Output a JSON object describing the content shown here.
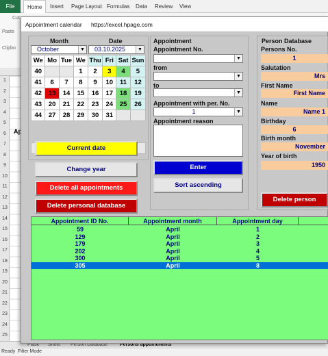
{
  "excel": {
    "tabs": [
      "File",
      "Home",
      "Insert",
      "Page Layout",
      "Formulas",
      "Data",
      "Review",
      "View"
    ],
    "ribbon_labels": [
      "Cut",
      "Paste",
      "Clipbo"
    ],
    "row_headers": [
      "1",
      "2",
      "3",
      "4",
      "5",
      "6",
      "7",
      "8",
      "9",
      "10",
      "11",
      "12",
      "13",
      "14",
      "15",
      "16",
      "17",
      "18",
      "19",
      "20",
      "21",
      "22",
      "23",
      "24",
      "25"
    ],
    "cell_text": "Ap",
    "sheet_tabs": [
      "Plask",
      "Sheet",
      "Person Database",
      "Persons appointments"
    ],
    "status": [
      "Ready",
      "Filter Mode"
    ]
  },
  "dialog": {
    "title": "Appointment calendar",
    "url": "https://excel.hpage.com"
  },
  "calendar": {
    "month_label": "Month",
    "date_label": "Date",
    "month_value": "October",
    "date_value": "03.10.2025",
    "day_headers": [
      "We",
      "Mo",
      "Tue",
      "We",
      "Thu",
      "Fri",
      "Sat",
      "Sun"
    ],
    "rows": [
      [
        "40",
        "",
        "",
        "1",
        "2",
        "3",
        "4",
        "5"
      ],
      [
        "41",
        "6",
        "7",
        "8",
        "9",
        "10",
        "11",
        "12"
      ],
      [
        "42",
        "13",
        "14",
        "15",
        "16",
        "17",
        "18",
        "19"
      ],
      [
        "43",
        "20",
        "21",
        "22",
        "23",
        "24",
        "25",
        "26"
      ],
      [
        "44",
        "27",
        "28",
        "29",
        "30",
        "31",
        "",
        ""
      ]
    ],
    "colors": {
      "today": "#ffff00",
      "weekend": "#7bde7b",
      "selected_week": "#e00000"
    }
  },
  "buttons": {
    "current_date": "Current date",
    "change_year": "Change year",
    "delete_all": "Delete all appointments",
    "delete_db": "Delete personal database",
    "enter": "Enter",
    "sort": "Sort ascending",
    "delete_person": "Delete person"
  },
  "appointment": {
    "heading": "Appointment",
    "no_label": "Appointment No.",
    "from_label": "from",
    "to_label": "to",
    "with_label": "Appointment with per. No.",
    "with_value": "1",
    "reason_label": "Appointment reason"
  },
  "person": {
    "heading": "Person Database",
    "persons_no_label": "Persons No.",
    "persons_no_value": "1",
    "salutation_label": "Salutation",
    "salutation_value": "Mrs",
    "first_name_label": "First Name",
    "first_name_value": "First Name",
    "name_label": "Name",
    "name_value": "Name 1",
    "birthday_label": "Birthday",
    "birthday_value": "6",
    "birth_month_label": "Birth month",
    "birth_month_value": "November",
    "year_label": "Year of birth",
    "year_value": "1950"
  },
  "list": {
    "headers": [
      "Appointment ID No.",
      "Appointment month",
      "Appointment day"
    ],
    "rows": [
      [
        "59",
        "April",
        "1"
      ],
      [
        "129",
        "April",
        "2"
      ],
      [
        "179",
        "April",
        "3"
      ],
      [
        "202",
        "April",
        "4"
      ],
      [
        "300",
        "April",
        "5"
      ],
      [
        "305",
        "April",
        "8"
      ]
    ],
    "selected_row": 5
  }
}
